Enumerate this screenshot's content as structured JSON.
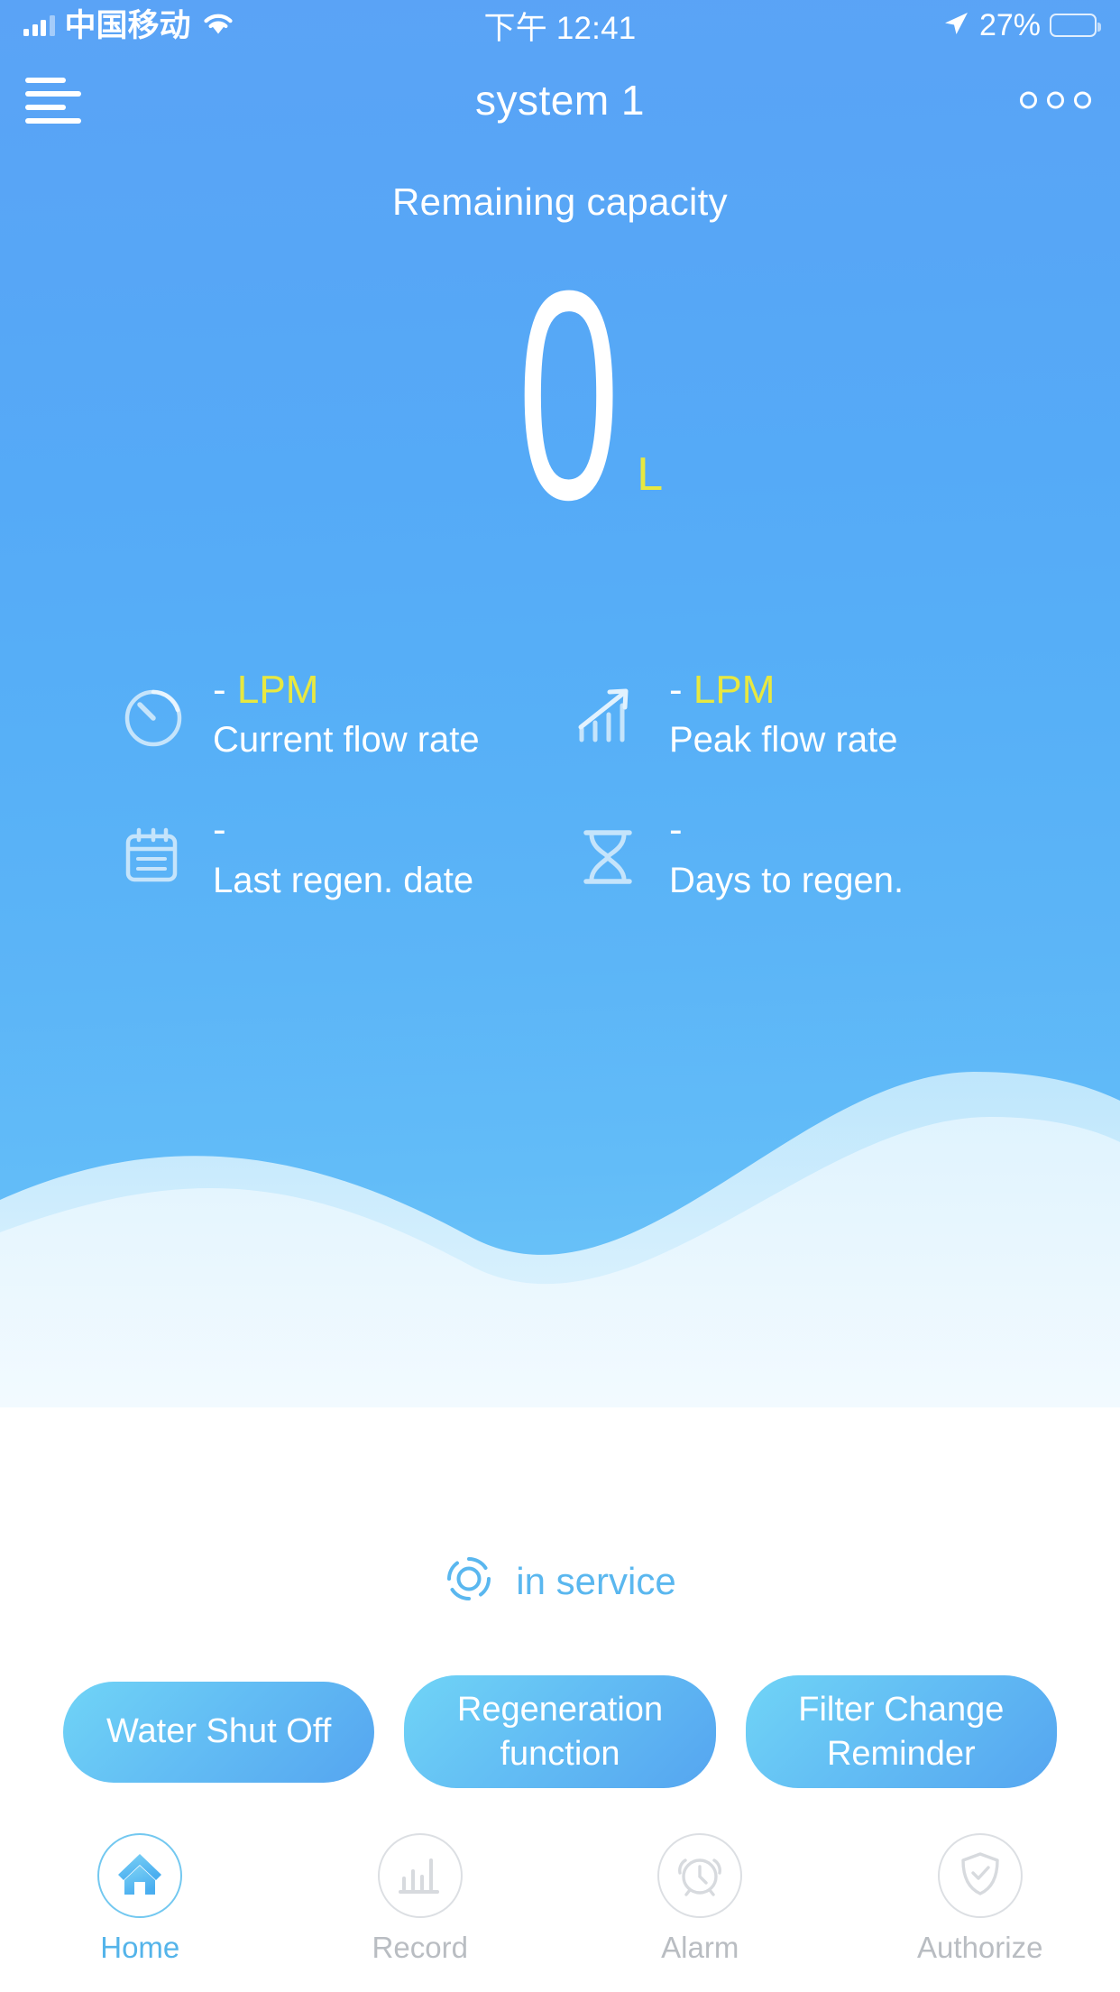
{
  "status_bar": {
    "carrier": "中国移动",
    "signal_icon": "signal-bars-icon",
    "wifi_icon": "wifi-icon",
    "time": "下午 12:41",
    "location_icon": "location-arrow-icon",
    "battery_percent": "27%",
    "battery_level": 27,
    "battery_fill_color": "#ffd633"
  },
  "nav": {
    "menu_icon": "hamburger-menu-icon",
    "title": "system 1",
    "more_icon": "more-options-icon"
  },
  "hero": {
    "label": "Remaining capacity",
    "value": "0",
    "unit": "L",
    "unit_color": "#e8e840"
  },
  "metrics": [
    {
      "icon": "gauge-icon",
      "value": "-",
      "unit": "LPM",
      "name": "Current flow rate"
    },
    {
      "icon": "bar-chart-arrow-icon",
      "value": "-",
      "unit": "LPM",
      "name": "Peak flow rate"
    },
    {
      "icon": "calendar-icon",
      "value": "-",
      "unit": "",
      "name": "Last regen. date"
    },
    {
      "icon": "hourglass-icon",
      "value": "-",
      "unit": "",
      "name": "Days to regen."
    }
  ],
  "service": {
    "icon": "service-ring-icon",
    "text": "in service",
    "color": "#5ab7ef"
  },
  "actions": [
    {
      "label": "Water Shut Off"
    },
    {
      "label": "Regeneration function"
    },
    {
      "label": "Filter Change Reminder"
    }
  ],
  "tabs": [
    {
      "label": "Home",
      "icon": "home-icon",
      "active": true
    },
    {
      "label": "Record",
      "icon": "bar-chart-icon",
      "active": false
    },
    {
      "label": "Alarm",
      "icon": "alarm-clock-icon",
      "active": false
    },
    {
      "label": "Authorize",
      "icon": "shield-check-icon",
      "active": false
    }
  ],
  "theme": {
    "sky_top": "#5aa3f6",
    "sky_bottom": "#7ccdf8",
    "accent_yellow": "#e8e840",
    "accent_blue": "#54b4ea"
  }
}
